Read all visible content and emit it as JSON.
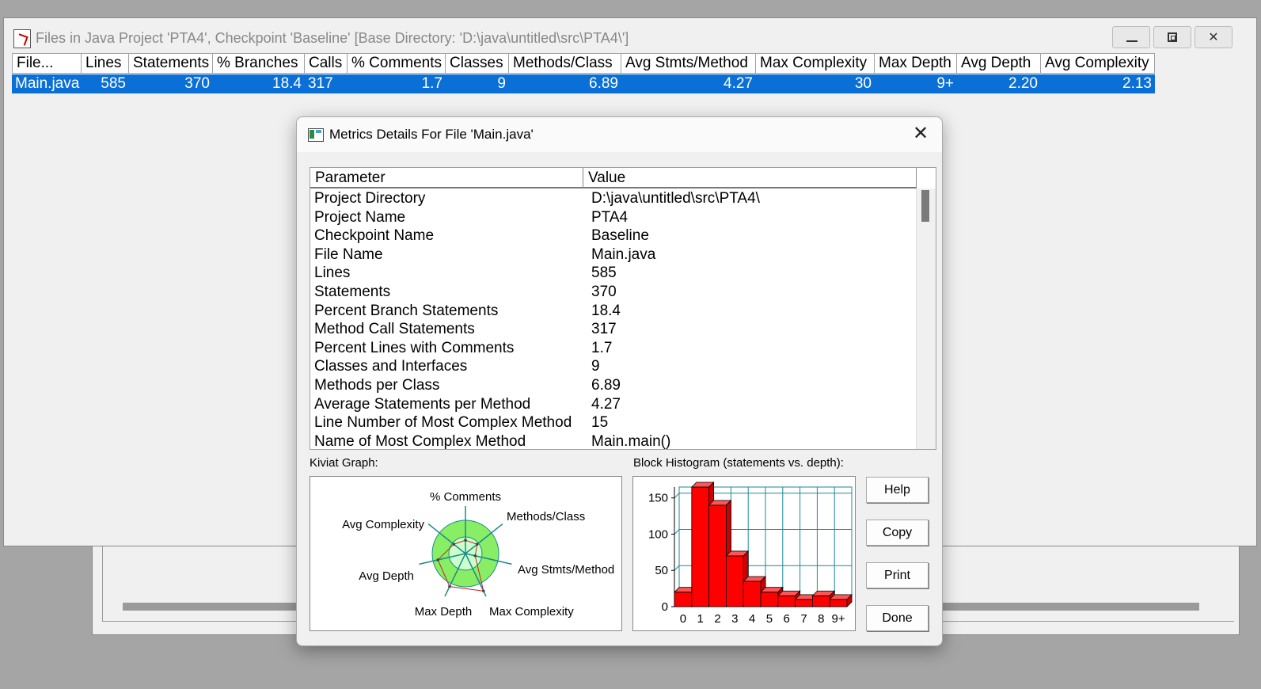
{
  "main_window": {
    "title": "Files in Java Project 'PTA4', Checkpoint 'Baseline'  [Base Directory: 'D:\\java\\untitled\\src\\PTA4\\']",
    "columns": [
      "File...",
      "Lines",
      "Statements",
      "% Branches",
      "Calls",
      "% Comments",
      "Classes",
      "Methods/Class",
      "Avg Stmts/Method",
      "Max Complexity",
      "Max Depth",
      "Avg Depth",
      "Avg Complexity"
    ],
    "rows": [
      [
        "Main.java",
        "585",
        "370",
        "18.4",
        "317",
        "1.7",
        "9",
        "6.89",
        "4.27",
        "30",
        "9+",
        "2.20",
        "2.13"
      ]
    ]
  },
  "dialog": {
    "title": "Metrics Details For File 'Main.java'",
    "close_glyph": "✕",
    "list_headers": [
      "Parameter",
      "Value"
    ],
    "params": [
      [
        "Project Directory",
        "D:\\java\\untitled\\src\\PTA4\\"
      ],
      [
        "Project Name",
        "PTA4"
      ],
      [
        "Checkpoint Name",
        "Baseline"
      ],
      [
        "File Name",
        "Main.java"
      ],
      [
        "Lines",
        "585"
      ],
      [
        "Statements",
        "370"
      ],
      [
        "Percent Branch Statements",
        "18.4"
      ],
      [
        "Method Call Statements",
        "317"
      ],
      [
        "Percent Lines with Comments",
        "1.7"
      ],
      [
        "Classes and Interfaces",
        "9"
      ],
      [
        "Methods per Class",
        "6.89"
      ],
      [
        "Average Statements per Method",
        "4.27"
      ],
      [
        "Line Number of Most Complex Method",
        "15"
      ],
      [
        "Name of Most Complex Method",
        "Main.main()"
      ]
    ],
    "kiviat_label": "Kiviat Graph:",
    "histogram_label": "Block Histogram (statements vs. depth):",
    "buttons": {
      "help": "Help",
      "copy": "Copy",
      "print": "Print",
      "done": "Done"
    }
  },
  "chart_data": [
    {
      "type": "kiviat",
      "axes": [
        "% Comments",
        "Methods/Class",
        "Avg Stmts/Method",
        "Max Complexity",
        "Max Depth",
        "Avg Depth",
        "Avg Complexity"
      ],
      "values": [
        0.4,
        0.45,
        0.3,
        1.25,
        1.1,
        0.85,
        0.45
      ],
      "inner_ring": 0.5,
      "outer_ring": 1.0,
      "colors": {
        "outer": "#88ee66",
        "inner": "#ccffcc",
        "axis": "#1a8a8a",
        "polygon": "#cc2222"
      }
    },
    {
      "type": "bar",
      "categories": [
        "0",
        "1",
        "2",
        "3",
        "4",
        "5",
        "6",
        "7",
        "8",
        "9+"
      ],
      "values": [
        20,
        165,
        140,
        70,
        35,
        20,
        15,
        10,
        15,
        10
      ],
      "yticks": [
        "0",
        "50",
        "100",
        "150"
      ],
      "ylim": [
        0,
        165
      ],
      "colors": {
        "bar": "#ff0000",
        "grid": "#1a8a9a"
      }
    }
  ]
}
